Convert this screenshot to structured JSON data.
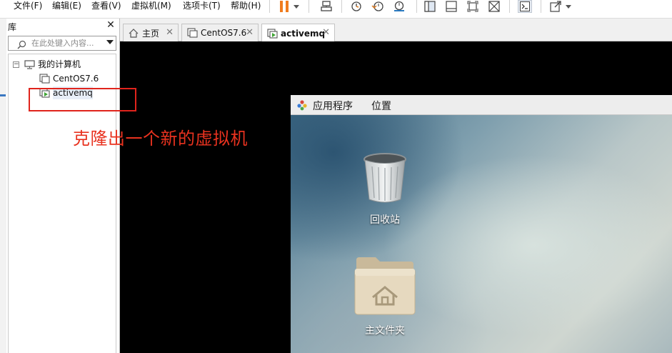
{
  "menu": {
    "file": "文件(F)",
    "edit": "编辑(E)",
    "view": "查看(V)",
    "vm": "虚拟机(M)",
    "tabs": "选项卡(T)",
    "help": "帮助(H)"
  },
  "toolbar": {
    "icons": [
      "pause-icon",
      "send-keys-icon",
      "snapshot-icon",
      "revert-snapshot-icon",
      "manage-snapshots-icon",
      "sidebar-view-icon",
      "thumbnail-view-icon",
      "fit-guest-icon",
      "unity-icon",
      "console-icon",
      "fullscreen-icon"
    ],
    "accent": "#f07c1e"
  },
  "library": {
    "title": "库",
    "search_placeholder": "在此处键入内容...",
    "tree": {
      "root": "我的计算机",
      "items": [
        "CentOS7.6",
        "activemq"
      ]
    }
  },
  "annotation": {
    "text": "克隆出一个新的虚拟机",
    "color": "#e0241c"
  },
  "tabs": [
    {
      "label": "主页",
      "icon": "home-icon"
    },
    {
      "label": "CentOS7.6",
      "icon": "vm-icon"
    },
    {
      "label": "activemq",
      "icon": "vm-running-icon",
      "active": true
    }
  ],
  "guest": {
    "panel": {
      "applications": "应用程序",
      "places": "位置"
    },
    "desktop_icons": [
      {
        "label": "回收站",
        "icon": "trash-icon"
      },
      {
        "label": "主文件夹",
        "icon": "home-folder-icon"
      }
    ]
  }
}
